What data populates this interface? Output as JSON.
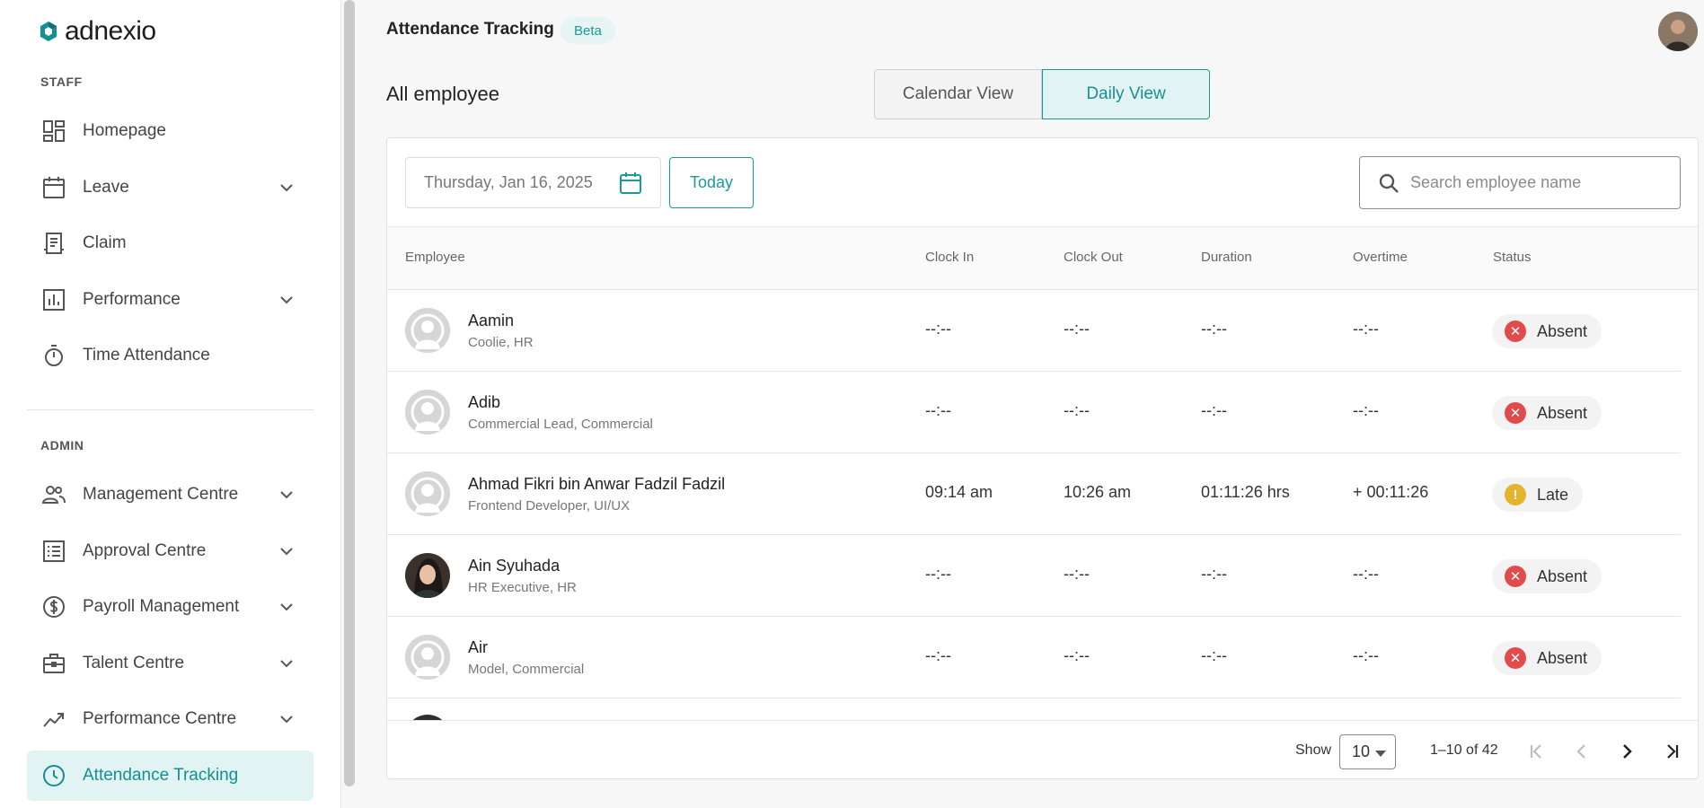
{
  "app": {
    "logo_text": "adnexio"
  },
  "sidebar": {
    "staff_label": "STAFF",
    "admin_label": "ADMIN",
    "staff_items": [
      {
        "label": "Homepage",
        "icon": "dashboard-icon",
        "expandable": false
      },
      {
        "label": "Leave",
        "icon": "calendar-icon",
        "expandable": true
      },
      {
        "label": "Claim",
        "icon": "receipt-icon",
        "expandable": false
      },
      {
        "label": "Performance",
        "icon": "bar-chart-icon",
        "expandable": true
      },
      {
        "label": "Time Attendance",
        "icon": "stopwatch-icon",
        "expandable": false
      }
    ],
    "admin_items": [
      {
        "label": "Management Centre",
        "icon": "people-icon",
        "expandable": true
      },
      {
        "label": "Approval Centre",
        "icon": "list-icon",
        "expandable": true
      },
      {
        "label": "Payroll Management",
        "icon": "dollar-icon",
        "expandable": true
      },
      {
        "label": "Talent Centre",
        "icon": "briefcase-icon",
        "expandable": true
      },
      {
        "label": "Performance Centre",
        "icon": "trend-icon",
        "expandable": true
      },
      {
        "label": "Attendance Tracking",
        "icon": "clock-icon",
        "expandable": false,
        "active": true
      }
    ]
  },
  "header": {
    "title": "Attendance Tracking",
    "badge": "Beta",
    "subtitle": "All employee",
    "views": {
      "calendar": "Calendar View",
      "daily": "Daily View",
      "active": "daily"
    }
  },
  "filters": {
    "date": "Thursday, Jan 16, 2025",
    "today_label": "Today",
    "search_placeholder": "Search employee name"
  },
  "table": {
    "headers": {
      "employee": "Employee",
      "clock_in": "Clock In",
      "clock_out": "Clock Out",
      "duration": "Duration",
      "overtime": "Overtime",
      "status": "Status"
    },
    "rows": [
      {
        "name": "Aamin",
        "role": "Coolie, HR",
        "clock_in": "--:--",
        "clock_out": "--:--",
        "duration": "--:--",
        "overtime": "--:--",
        "status": "Absent",
        "photo": false
      },
      {
        "name": "Adib",
        "role": "Commercial Lead, Commercial",
        "clock_in": "--:--",
        "clock_out": "--:--",
        "duration": "--:--",
        "overtime": "--:--",
        "status": "Absent",
        "photo": false
      },
      {
        "name": "Ahmad Fikri bin Anwar Fadzil Fadzil",
        "role": "Frontend Developer, UI/UX",
        "clock_in": "09:14 am",
        "clock_out": "10:26 am",
        "duration": "01:11:26 hrs",
        "overtime": "+ 00:11:26",
        "status": "Late",
        "photo": false
      },
      {
        "name": "Ain Syuhada",
        "role": "HR Executive, HR",
        "clock_in": "--:--",
        "clock_out": "--:--",
        "duration": "--:--",
        "overtime": "--:--",
        "status": "Absent",
        "photo": true
      },
      {
        "name": "Air",
        "role": "Model, Commercial",
        "clock_in": "--:--",
        "clock_out": "--:--",
        "duration": "--:--",
        "overtime": "--:--",
        "status": "Absent",
        "photo": false
      }
    ]
  },
  "pagination": {
    "show_label": "Show",
    "page_size": "10",
    "range": "1–10 of 42"
  },
  "colors": {
    "accent": "#1a9a98",
    "absent": "#e24b4b",
    "late": "#e5b42d"
  }
}
